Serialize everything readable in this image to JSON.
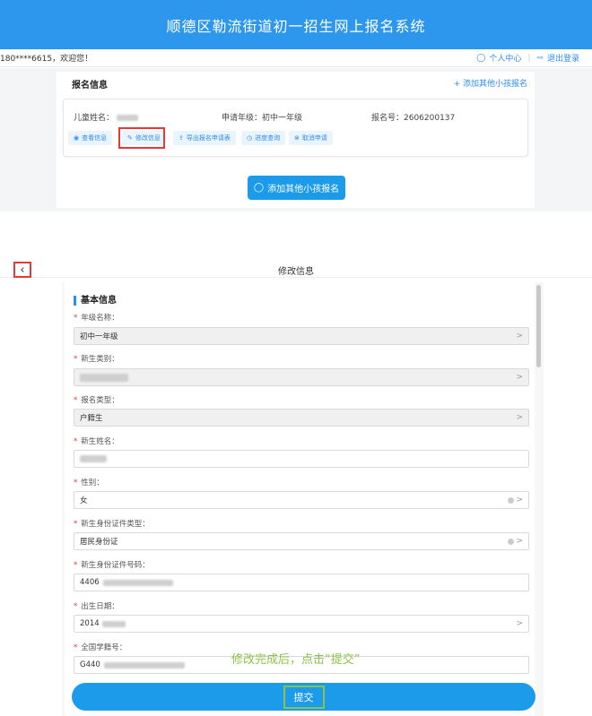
{
  "top": {
    "header_title": "顺德区勒流街道初一招生网上报名系统",
    "user_prefix": "180****6615",
    "user_greeting": "，欢迎您！",
    "personal_center": "个人中心",
    "logout": "退出登录",
    "panel_title": "报名信息",
    "add_link": "+ 添加其他小孩报名",
    "child_name_label": "儿童姓名：",
    "grade_label": "申请年级：初中一年级",
    "reg_no_label": "报名号：2606200137",
    "actions": [
      "查看信息",
      "修改信息",
      "导出报名申请表",
      "进度查询",
      "取消申请"
    ],
    "add_child_button": "添加其他小孩报名"
  },
  "modal": {
    "title": "修改信息",
    "section_title": "基本信息",
    "fields": [
      {
        "label": "年级名称：",
        "value": "初中一年级"
      },
      {
        "label": "新生类别：",
        "value": ""
      },
      {
        "label": "报名类型：",
        "value": "户籍生"
      },
      {
        "label": "新生姓名：",
        "value": ""
      },
      {
        "label": "性别：",
        "value": "女"
      },
      {
        "label": "新生身份证件类型：",
        "value": "居民身份证"
      },
      {
        "label": "新生身份证件号码：",
        "value": "4406"
      },
      {
        "label": "出生日期：",
        "value": "2014"
      },
      {
        "label": "全国学籍号：",
        "value": "G440"
      }
    ],
    "hint": "修改完成后，点击“提交”",
    "submit": "提交"
  }
}
